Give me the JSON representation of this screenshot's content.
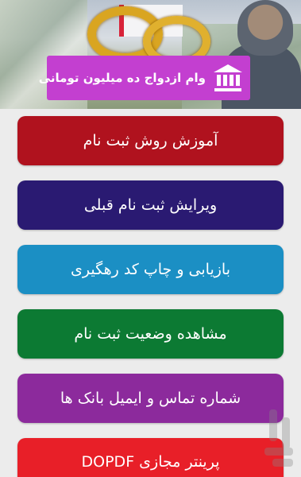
{
  "header": {
    "title": "وام ازدواج ده میلیون تومانی",
    "icon": "bank-icon"
  },
  "menu": {
    "items": [
      {
        "label": "آموزش روش ثبت نام",
        "color": "#b0121e"
      },
      {
        "label": "ویرایش ثبت نام قبلی",
        "color": "#2a1a72"
      },
      {
        "label": "بازیابی و چاپ کد رهگیری",
        "color": "#1b8fc4"
      },
      {
        "label": "مشاهده وضعیت ثبت نام",
        "color": "#0c7a33"
      },
      {
        "label": "شماره تماس و ایمیل بانک ها",
        "color": "#8c2a9c"
      },
      {
        "label": "پرینتر مجازی DOPDF",
        "color": "#e81f28"
      }
    ]
  },
  "colors": {
    "title_bar": "#c33fd0",
    "background": "#ececec"
  }
}
